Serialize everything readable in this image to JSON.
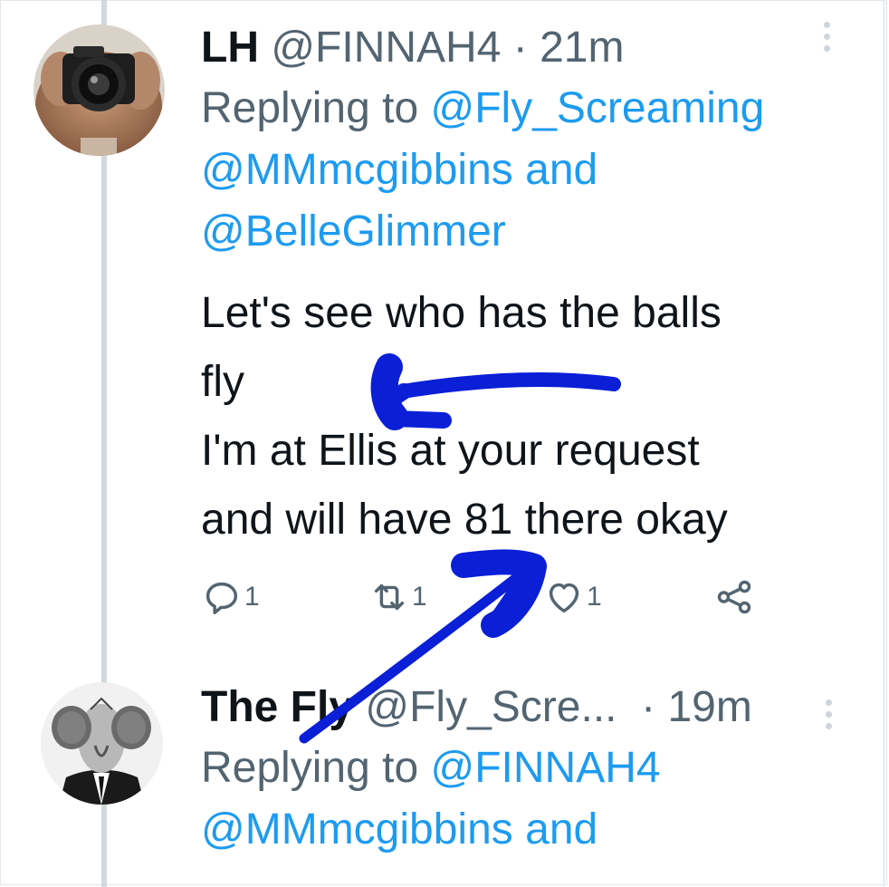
{
  "tweet1": {
    "name": "LH",
    "handle": "@FINNAH4",
    "separator": "·",
    "time": "21m",
    "replying_prefix": "Replying to",
    "mention1": "@Fly_Screaming",
    "mention2": "@MMmcgibbins",
    "and_word": "and",
    "mention3": "@BelleGlimmer",
    "lines": [
      "Let's see who has the balls",
      "fly",
      "I'm at Ellis at your request",
      "and will have 81 there okay"
    ],
    "reply_count": "1",
    "retweet_count": "1",
    "like_count": "1"
  },
  "tweet2": {
    "name": "The Fly",
    "handle": "@Fly_Scre...",
    "separator": "·",
    "time": "19m",
    "replying_prefix": "Replying to",
    "mention1": "@FINNAH4",
    "mention2": "@MMmcgibbins",
    "and_word": "and"
  },
  "icons": {
    "reply": "reply-icon",
    "retweet": "retweet-icon",
    "like": "heart-icon",
    "share": "share-icon",
    "more": "more-icon"
  },
  "colors": {
    "text": "#0f1419",
    "secondary": "#536471",
    "mention": "#1d9bf0",
    "thread_line": "#cfd9de",
    "annotation": "#0a1fd6"
  }
}
